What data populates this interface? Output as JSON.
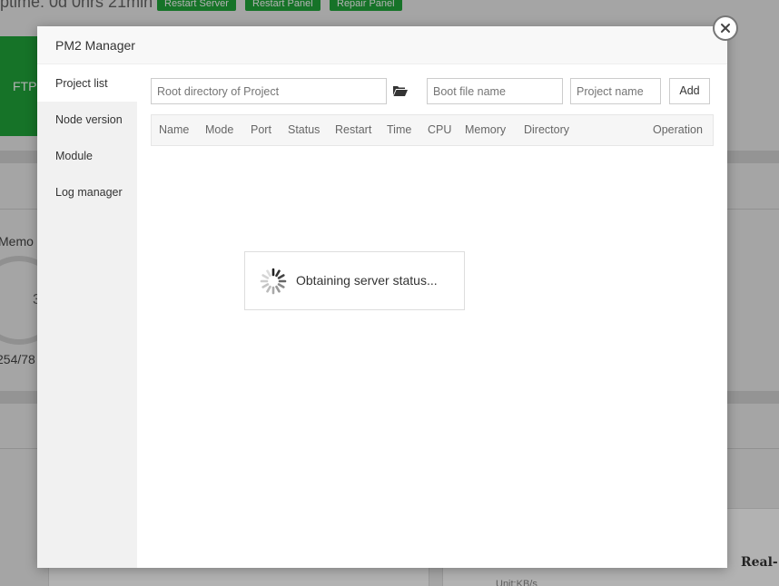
{
  "background": {
    "uptime_text": "ptime: 0d 0hrs 21min",
    "buttons": [
      "Restart Server",
      "Restart Panel",
      "Repair Panel"
    ],
    "ftp_label": "FTP",
    "memory_label": "Memo",
    "memory_ring_value": "3",
    "memory_value": "254/78",
    "real_label": "Real-",
    "unit_label": "Unit:KB/s"
  },
  "dialog": {
    "title": "PM2 Manager",
    "close_icon": "close-icon",
    "sidebar": {
      "items": [
        {
          "label": "Project list",
          "active": true
        },
        {
          "label": "Node version",
          "active": false
        },
        {
          "label": "Module",
          "active": false
        },
        {
          "label": "Log manager",
          "active": false
        }
      ]
    },
    "form": {
      "root_dir_placeholder": "Root directory of Project",
      "folder_icon": "folder-open-icon",
      "boot_file_placeholder": "Boot file name",
      "project_name_placeholder": "Project name",
      "add_label": "Add"
    },
    "table": {
      "columns": [
        "Name",
        "Mode",
        "Port",
        "Status",
        "Restart",
        "Time",
        "CPU",
        "Memory",
        "Directory",
        "Operation"
      ]
    }
  },
  "loading": {
    "text": "Obtaining server status...",
    "icon": "spinner-icon"
  }
}
